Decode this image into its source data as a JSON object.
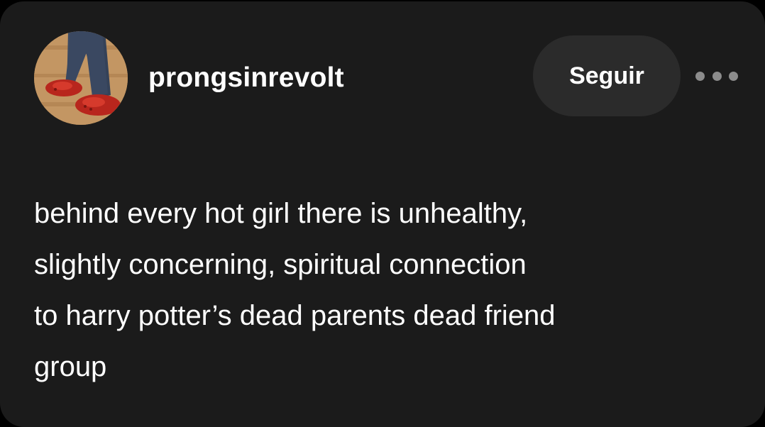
{
  "post": {
    "author": {
      "username": "prongsinrevolt",
      "avatar_icon": "avatar-photo-red-clogs"
    },
    "follow_label": "Seguir",
    "more_icon": "more-options-icon",
    "body_lines": [
      "behind every hot girl there is unhealthy,",
      "slightly concerning, spiritual connection",
      "to harry potter’s dead parents dead friend",
      "group"
    ]
  },
  "colors": {
    "background": "#1b1b1b",
    "button": "#2b2b2b",
    "text": "#ffffff",
    "dots": "#8c8c8c"
  }
}
